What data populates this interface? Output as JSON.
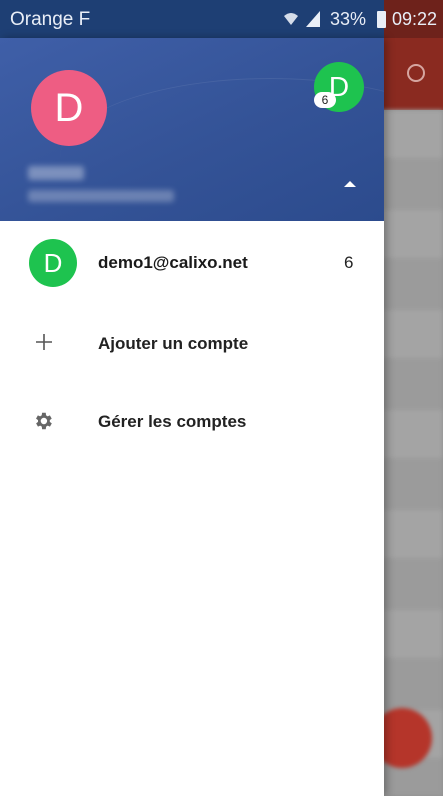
{
  "status_bar": {
    "carrier": "Orange F",
    "battery": "33%",
    "time": "09:22",
    "icons": [
      "wifi-icon",
      "signal-icon",
      "battery-icon"
    ]
  },
  "drawer": {
    "header": {
      "avatar_letter": "D",
      "secondary_avatar_letter": "D",
      "secondary_avatar_badge": "6",
      "header_color": "#345397"
    },
    "accounts": [
      {
        "avatar_letter": "D",
        "email": "demo1@calixo.net",
        "count": "6",
        "avatar_color": "#1ec34f"
      }
    ],
    "add_account_label": "Ajouter un compte",
    "manage_accounts_label": "Gérer les comptes"
  },
  "colors": {
    "primary_avatar": "#ee5d83",
    "secondary_avatar": "#1ec34f",
    "app_bar_behind": "#8a2a20"
  }
}
